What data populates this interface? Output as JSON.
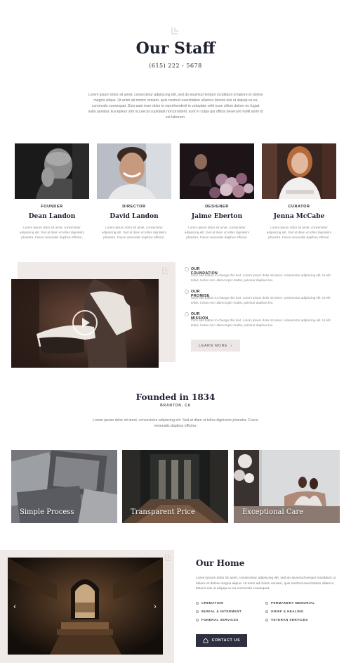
{
  "header": {
    "title": "Our Staff",
    "phone": "(615) 222 - 5678",
    "intro": "Lorem ipsum dolor sit amet, consectetur adipiscing elit, sed do eiusmod tempor incididunt ut labore et dolore magna aliqua. Ut enim ad minim veniam, quis nostrud exercitation ullamco laboris nisi ut aliquip ex ea commodo consequat. Duis aute irure dolor in reprehenderit in voluptate velit esse cillum dolore eu fugiat nulla pariatur. Excepteur sint occaecat cupidatat non proident, sunt in culpa qui officia deserunt mollit anim id est laborum."
  },
  "staff": [
    {
      "role": "FOUNDER",
      "name": "Dean Landon",
      "bio": "Lorem ipsum dolor sit amet, consectetur adipiscing elit. Sed at diam ut tellus dignissim pharetra. Fusce venenatis dapibus efficitur."
    },
    {
      "role": "DIRECTOR",
      "name": "David Landon",
      "bio": "Lorem ipsum dolor sit amet, consectetur adipiscing elit. Sed at diam ut tellus dignissim pharetra. Fusce venenatis dapibus efficitur."
    },
    {
      "role": "DESIGNER",
      "name": "Jaime Eberton",
      "bio": "Lorem ipsum dolor sit amet, consectetur adipiscing elit. Sed at diam ut tellus dignissim pharetra. Fusce venenatis dapibus efficitur."
    },
    {
      "role": "CURATOR",
      "name": "Jenna McCabe",
      "bio": "Lorem ipsum dolor sit amet, consectetur adipiscing elit. Sed at diam ut tellus dignissim pharetra. Fusce venenatis dapibus efficitur."
    }
  ],
  "features": [
    {
      "title": "OUR FOUNDATION",
      "text": "Click edit button to change this text. Lorem ipsum dolor sit amet, consectetur adipiscing elit. Ut elit tellus, luctus nec ullamcorper mattis, pulvinar dapibus leo."
    },
    {
      "title": "OUR PROMISE",
      "text": "Click edit button to change this text. Lorem ipsum dolor sit amet, consectetur adipiscing elit. Ut elit tellus, luctus nec ullamcorper mattis, pulvinar dapibus leo."
    },
    {
      "title": "OUR MISSION",
      "text": "Click edit button to change this text. Lorem ipsum dolor sit amet, consectetur adipiscing elit. Ut elit tellus, luctus nec ullamcorper mattis, pulvinar dapibus leo."
    }
  ],
  "learn_more": {
    "label": "LEARN MORE",
    "arrow": "›"
  },
  "founded": {
    "title": "Founded in 1834",
    "location": "BRANTON, CA",
    "text": "Lorem ipsum dolor sit amet, consectetur adipiscing elit. Sed at diam ut tellus dignissim pharetra. Fusce venenatis dapibus efficitur."
  },
  "services_cards": [
    {
      "label": "Simple Process"
    },
    {
      "label": "Transparent Price"
    },
    {
      "label": "Exceptional Care"
    }
  ],
  "home": {
    "title": "Our Home",
    "text": "Lorem ipsum dolor sit amet, consectetur adipiscing elit, sed do eiusmod tempor incididunt ut labore et dolore magna aliqua. Ut enim ad minim veniam, quis nostrud exercitation ullamco laboris nisi ut aliquip ex ea commodo consequat.",
    "services": [
      "CREMATION",
      "PERMANENT MEMORIAL",
      "BURIAL & INTERMENT",
      "GRIEF & HEALING",
      "FUNERAL SERVICES",
      "VETERAN SERVICES"
    ],
    "contact_label": "CONTACT US",
    "prev_arrow": "‹",
    "next_arrow": "›"
  },
  "colors": {
    "accent_bg": "#efe9e8",
    "dark_button": "#2e3040",
    "heading": "#1f2230"
  },
  "icons": [
    "note-icon",
    "play-icon",
    "circle-icon",
    "home-icon",
    "chevron-left-icon",
    "chevron-right-icon"
  ]
}
